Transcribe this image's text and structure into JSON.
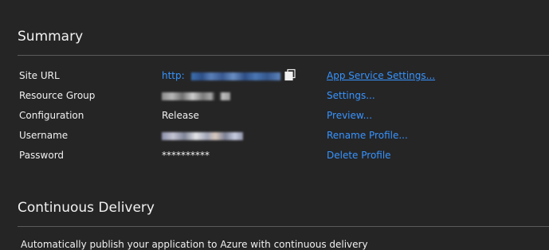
{
  "summary": {
    "title": "Summary",
    "rows": [
      {
        "label": "Site URL",
        "value": "http:",
        "action": "App Service Settings..."
      },
      {
        "label": "Resource Group",
        "value": "",
        "action": "Settings..."
      },
      {
        "label": "Configuration",
        "value": "Release",
        "action": "Preview..."
      },
      {
        "label": "Username",
        "value": "",
        "action": "Rename Profile..."
      },
      {
        "label": "Password",
        "value": "**********",
        "action": "Delete Profile"
      }
    ],
    "copy_icon": "copy-icon"
  },
  "continuous_delivery": {
    "title": "Continuous Delivery",
    "description": "Automatically publish your application to Azure with continuous delivery"
  },
  "colors": {
    "background": "#252526",
    "text": "#f1f1f1",
    "link": "#3794ff",
    "divider": "#5a5a5a"
  }
}
